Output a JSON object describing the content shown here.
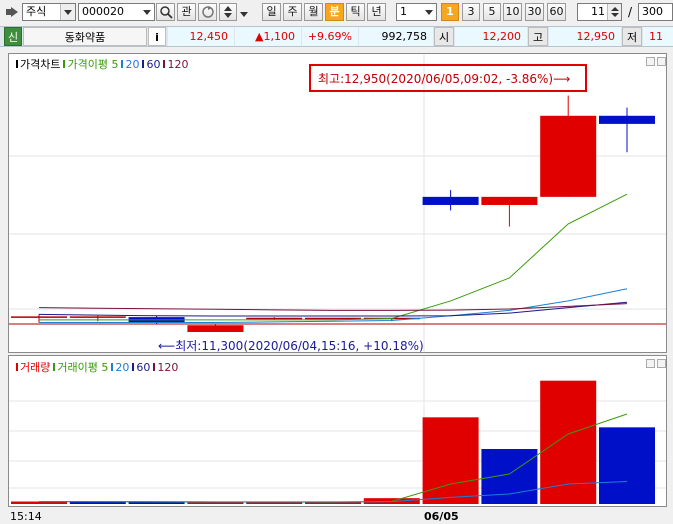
{
  "toolbar": {
    "window_icon": "window-icon",
    "market_select": "주식",
    "code_input": "000020",
    "search_icon": "search-icon",
    "kwan_label": "관",
    "refresh_icon": "refresh-icon",
    "period_buttons": [
      "일",
      "주",
      "월",
      "분",
      "틱",
      "년"
    ],
    "active_period": "분",
    "interval_select": "1",
    "quick_intervals": [
      "1",
      "3",
      "5",
      "10",
      "30",
      "60"
    ],
    "active_interval": "1",
    "count_input": "11",
    "slash": "/",
    "total_input": "300"
  },
  "quote": {
    "new_badge": "신",
    "name": "동화약품",
    "info_icon": "i",
    "price": "12,450",
    "change": "▲1,100",
    "change_pct": "+9.69%",
    "volume": "992,758",
    "open_label": "시",
    "open": "12,200",
    "high_label": "고",
    "high": "12,950",
    "low_label": "저",
    "low_partial": "11"
  },
  "colors": {
    "up": "#e00000",
    "down": "#0010c8",
    "ma5": "#3a9a0a",
    "ma20": "#1b7fd6",
    "ma60": "#1a1a8a",
    "ma120": "#7a1040"
  },
  "price_chart": {
    "legend": [
      {
        "text": "가격차트",
        "color": "#000000"
      },
      {
        "text": "가격이평 5",
        "color": "#3a9a0a"
      },
      {
        "text": "20",
        "color": "#1b7fd6"
      },
      {
        "text": "60",
        "color": "#1a1a8a"
      },
      {
        "text": "120",
        "color": "#7a1040"
      }
    ],
    "high_annotation": "최고:12,950(2020/06/05,09:02, -3.86%)⟶",
    "low_annotation": "⟵최저:11,300(2020/06/04,15:16, +10.18%)"
  },
  "volume_chart": {
    "legend": [
      {
        "text": "거래량",
        "color": "#e00000"
      },
      {
        "text": "거래이평 5",
        "color": "#3a9a0a"
      },
      {
        "text": "20",
        "color": "#1b7fd6"
      },
      {
        "text": "60",
        "color": "#1a1a8a"
      },
      {
        "text": "120",
        "color": "#7a1040"
      }
    ]
  },
  "x_axis": {
    "labels": [
      "15:14",
      "06/05"
    ]
  },
  "chart_data": {
    "type": "candlestick",
    "ylim": [
      11200,
      13050
    ],
    "candles": [
      {
        "open": 11310,
        "close": 11300,
        "high": 11330,
        "low": 11270,
        "dir": "flat"
      },
      {
        "open": 11310,
        "close": 11300,
        "high": 11320,
        "low": 11280,
        "dir": "flat"
      },
      {
        "open": 11310,
        "close": 11270,
        "high": 11320,
        "low": 11260,
        "dir": "down"
      },
      {
        "open": 11250,
        "close": 11200,
        "high": 11260,
        "low": 11200,
        "dir": "up"
      },
      {
        "open": 11300,
        "close": 11300,
        "high": 11310,
        "low": 11290,
        "dir": "flat"
      },
      {
        "open": 11300,
        "close": 11300,
        "high": 11300,
        "low": 11300,
        "dir": "flat"
      },
      {
        "open": 11290,
        "close": 11300,
        "high": 11300,
        "low": 11280,
        "dir": "flat"
      },
      {
        "open": 12200,
        "close": 12140,
        "high": 12250,
        "low": 12100,
        "dir": "down"
      },
      {
        "open": 12140,
        "close": 12200,
        "high": 12200,
        "low": 11980,
        "dir": "up"
      },
      {
        "open": 12200,
        "close": 12800,
        "high": 12950,
        "low": 12200,
        "dir": "up"
      },
      {
        "open": 12800,
        "close": 12740,
        "high": 12860,
        "low": 12530,
        "dir": "down"
      }
    ],
    "ma": {
      "ma5": [
        11290,
        11290,
        11290,
        11290,
        11290,
        11290,
        11300,
        11430,
        11600,
        12000,
        12220
      ],
      "ma20": [
        11270,
        11270,
        11270,
        11270,
        11275,
        11280,
        11285,
        11320,
        11360,
        11430,
        11520
      ],
      "ma60": [
        11330,
        11325,
        11320,
        11318,
        11318,
        11318,
        11318,
        11320,
        11340,
        11380,
        11420
      ],
      "ma120": [
        11380,
        11376,
        11372,
        11368,
        11364,
        11360,
        11360,
        11362,
        11370,
        11390,
        11410
      ]
    },
    "volume": [
      15,
      14,
      12,
      10,
      10,
      12,
      35,
      520,
      330,
      740,
      460
    ],
    "volume_dir": [
      "up",
      "down",
      "down",
      "up",
      "up",
      "up",
      "up",
      "up",
      "down",
      "up",
      "down"
    ],
    "volume_ylim": [
      0,
      780
    ],
    "volume_ma": {
      "ma5": [
        15,
        14,
        13,
        12,
        12,
        11,
        16,
        120,
        180,
        420,
        540
      ],
      "ma20": [
        14,
        14,
        14,
        13,
        13,
        13,
        14,
        40,
        60,
        120,
        135
      ]
    }
  }
}
